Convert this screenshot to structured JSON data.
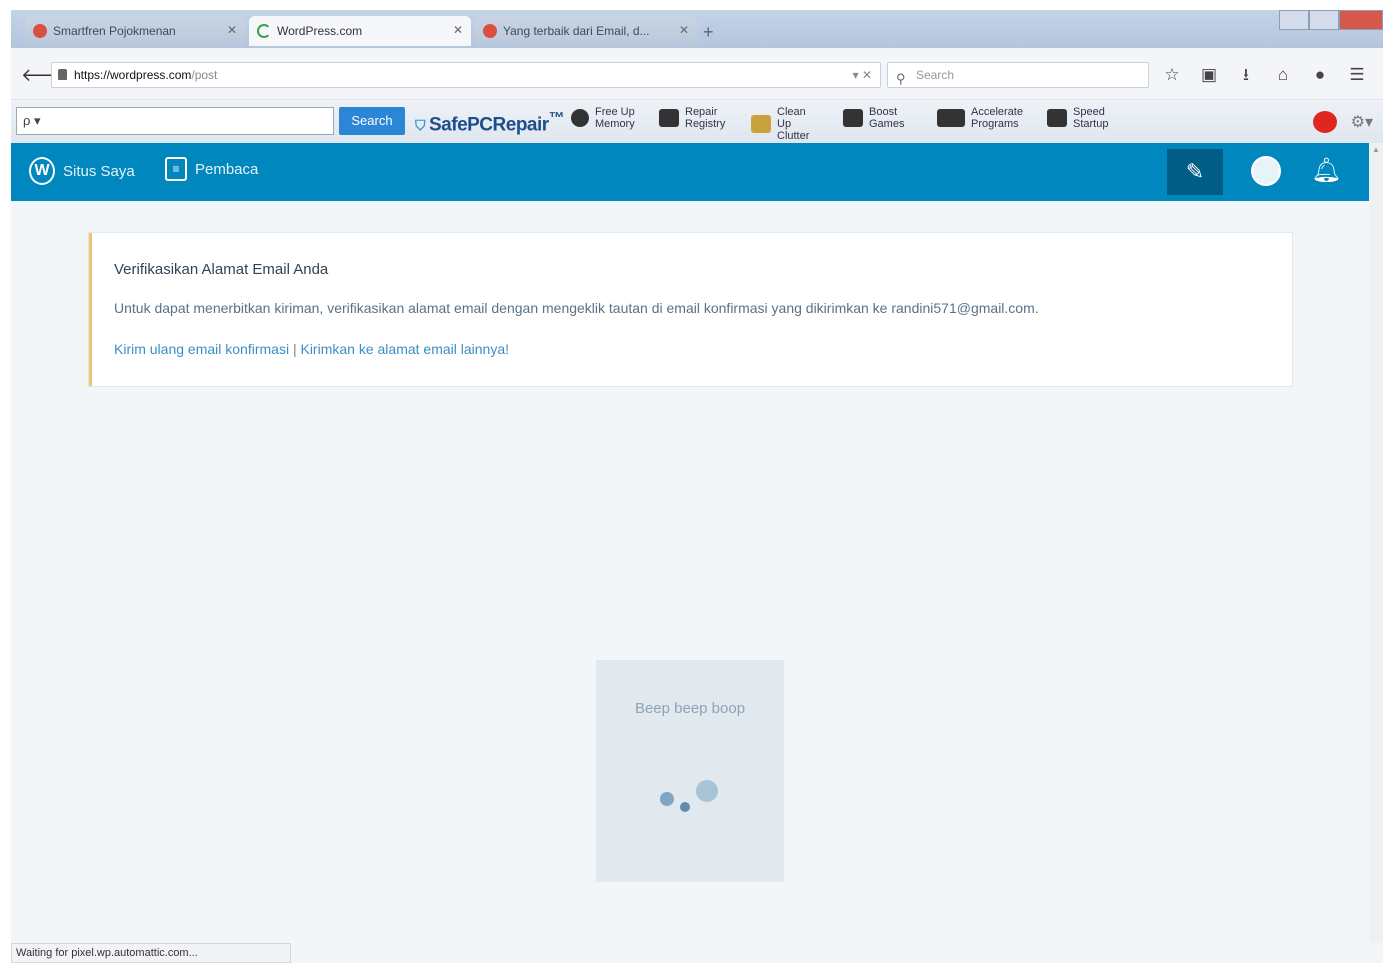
{
  "browser": {
    "tabs": [
      {
        "label": "Smartfren Pojokmenan",
        "active": false,
        "icon_color": "#d9503f"
      },
      {
        "label": "WordPress.com",
        "active": true,
        "icon_color": "#3aa14a"
      },
      {
        "label": "Yang terbaik dari Email, d...",
        "active": false,
        "icon_color": "#d9503f"
      }
    ],
    "new_tab": "+",
    "url_host": "https://wordpress.com",
    "url_path": "/post",
    "search_placeholder": "Search"
  },
  "toolbar": {
    "input_value": "ρ ▾",
    "search_button": "Search",
    "brand": "SafePCRepair",
    "items": [
      {
        "label": "Free Up Memory",
        "icon": "memory-icon"
      },
      {
        "label": "Repair Registry",
        "icon": "registry-icon"
      },
      {
        "label": "Clean Up Clutter",
        "icon": "clutter-icon"
      },
      {
        "label": "Boost Games",
        "icon": "games-icon"
      },
      {
        "label": "Accelerate Programs",
        "icon": "programs-icon"
      },
      {
        "label": "Speed Startup",
        "icon": "startup-icon"
      }
    ]
  },
  "masterbar": {
    "my_site": "Situs Saya",
    "reader": "Pembaca",
    "color": "#0087be"
  },
  "notice": {
    "title": "Verifikasikan Alamat Email Anda",
    "text": "Untuk dapat menerbitkan kiriman, verifikasikan alamat email dengan mengeklik tautan di email konfirmasi yang dikirimkan ke randini571@gmail.com.",
    "resend_link": "Kirim ulang email konfirmasi",
    "separator": "|",
    "change_link": "Kirimkan ke alamat email lainnya!"
  },
  "loader": {
    "text": "Beep beep boop"
  },
  "status": {
    "text": "Waiting for pixel.wp.automattic.com..."
  }
}
